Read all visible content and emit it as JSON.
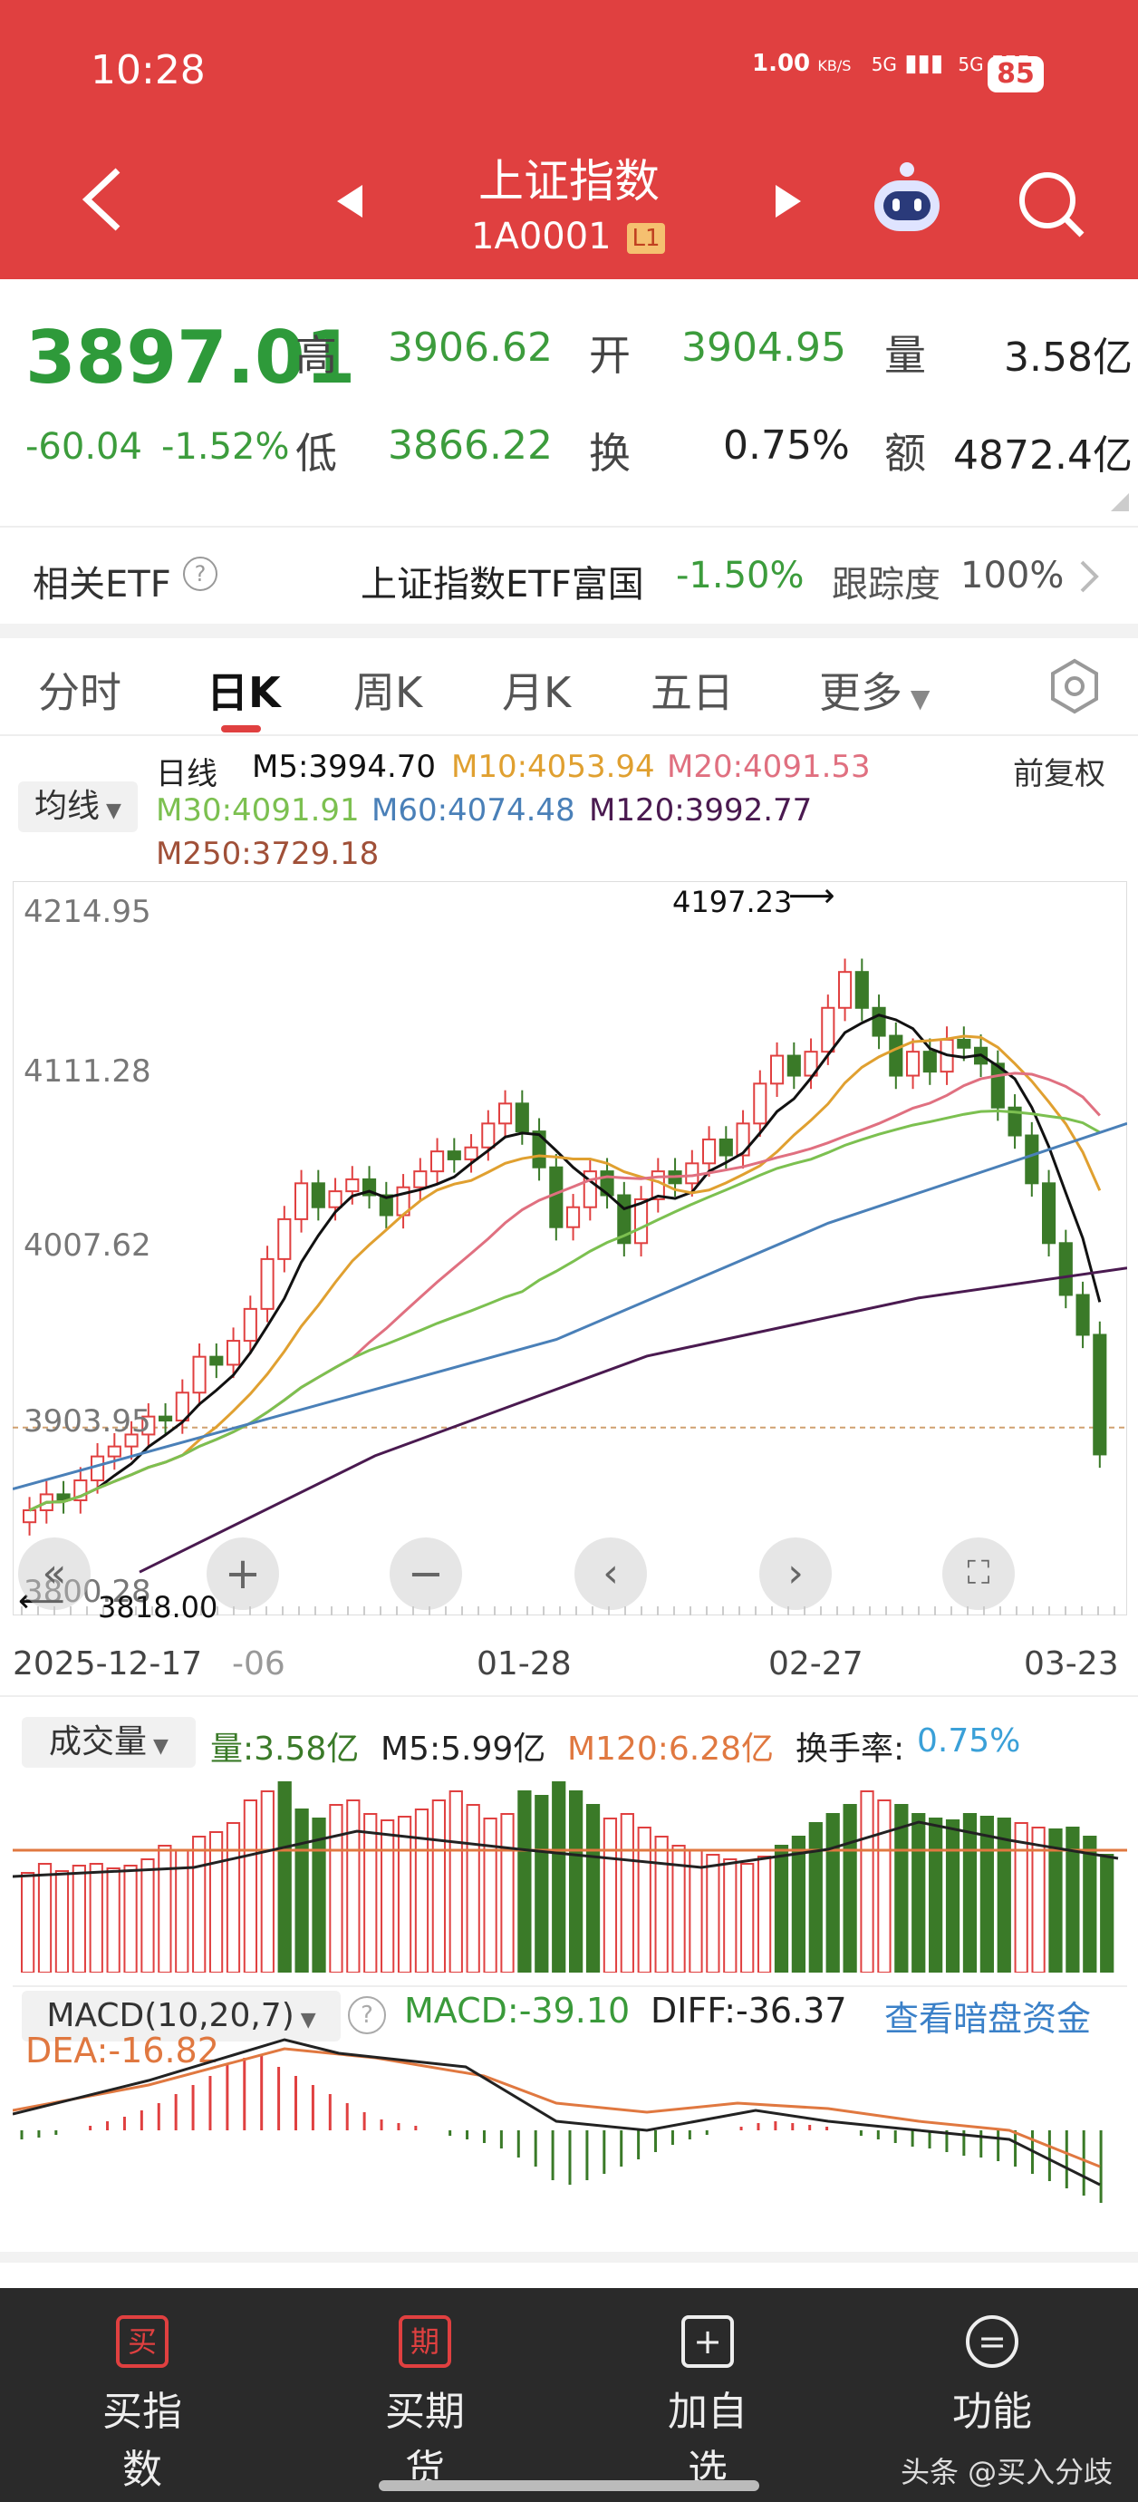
{
  "status": {
    "time": "10:28",
    "speed": "1.00",
    "speed_unit": "KB/S",
    "net1": "5G",
    "net2": "5G",
    "battery": "85"
  },
  "header": {
    "title": "上证指数",
    "code": "1A0001",
    "level": "L1"
  },
  "quote": {
    "price": "3897.01",
    "change": "-60.04",
    "change_pct": "-1.52%",
    "high_label": "高",
    "high": "3906.62",
    "open_label": "开",
    "open": "3904.95",
    "vol_label": "量",
    "vol": "3.58亿",
    "low_label": "低",
    "low": "3866.22",
    "turnover_label": "换",
    "turnover": "0.75%",
    "amount_label": "额",
    "amount": "4872.4亿"
  },
  "etf": {
    "label": "相关ETF",
    "name": "上证指数ETF富国",
    "pct": "-1.50%",
    "track_label": "跟踪度",
    "track": "100%"
  },
  "tabs": [
    "分时",
    "日K",
    "周K",
    "月K",
    "五日",
    "更多"
  ],
  "active_tab": "日K",
  "kline": {
    "indicator_btn": "均线",
    "period": "日线",
    "adjust": "前复权",
    "ma": {
      "m5": "M5:3994.70",
      "m10": "M10:4053.94",
      "m20": "M20:4091.53",
      "m30": "M30:4091.91",
      "m60": "M60:4074.48",
      "m120": "M120:3992.77",
      "m250": "M250:3729.18"
    },
    "y_ticks": [
      "4214.95",
      "4111.28",
      "4007.62",
      "3903.95",
      "3800.28"
    ],
    "max_mark": "4197.23",
    "min_mark": "3818.00",
    "dates": [
      "2025-12-17",
      "-06",
      "01-28",
      "02-27",
      "03-23"
    ]
  },
  "volume": {
    "btn": "成交量",
    "vol": "量:3.58亿",
    "m5": "M5:5.99亿",
    "m120": "M120:6.28亿",
    "turn_label": "换手率:",
    "turn": "0.75%"
  },
  "macd": {
    "btn": "MACD(10,20,7)",
    "macd": "MACD:-39.10",
    "diff": "DIFF:-36.37",
    "link": "查看暗盘资金",
    "dea": "DEA:-16.82"
  },
  "bottom_nav": [
    {
      "label": "买指数",
      "icon": "买"
    },
    {
      "label": "买期货",
      "icon": "期"
    },
    {
      "label": "加自选",
      "icon": "+"
    },
    {
      "label": "功能",
      "icon": "="
    }
  ],
  "watermark": "头条 @买入分歧",
  "colors": {
    "up": "#e04040",
    "down": "#3a7a28",
    "header": "#e04040",
    "m5": "#111111",
    "m10": "#e0a030",
    "m20": "#e07080",
    "m30": "#7cc050",
    "m60": "#4a80b8",
    "m120": "#4a1a50",
    "m250": "#a05038"
  }
}
